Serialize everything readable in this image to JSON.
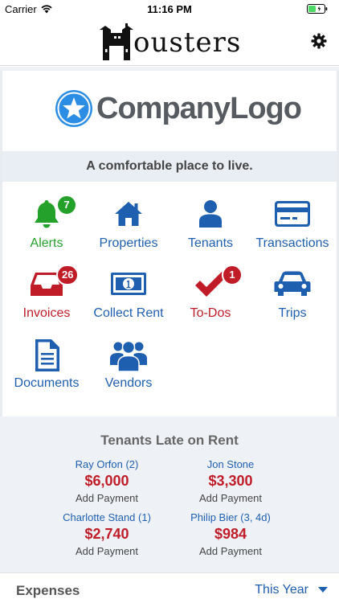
{
  "status_bar": {
    "carrier": "Carrier",
    "time": "11:16 PM"
  },
  "header": {
    "title": "ousters",
    "settings_icon": "gear-icon"
  },
  "company": {
    "logo_text": "CompanyLogo",
    "tagline": "A comfortable place to live."
  },
  "tiles": [
    {
      "label": "Alerts",
      "icon": "bell-icon",
      "badge": "7"
    },
    {
      "label": "Properties",
      "icon": "house-icon"
    },
    {
      "label": "Tenants",
      "icon": "person-icon"
    },
    {
      "label": "Transactions",
      "icon": "credit-card-icon"
    },
    {
      "label": "Invoices",
      "icon": "inbox-tray-icon",
      "badge": "26"
    },
    {
      "label": "Collect Rent",
      "icon": "banknote-icon"
    },
    {
      "label": "To-Dos",
      "icon": "checkmark-icon",
      "badge": "1"
    },
    {
      "label": "Trips",
      "icon": "car-icon"
    },
    {
      "label": "Documents",
      "icon": "document-icon"
    },
    {
      "label": "Vendors",
      "icon": "group-icon"
    }
  ],
  "late_rent": {
    "title": "Tenants Late on Rent",
    "entries": [
      {
        "name": "Ray Orfon (2)",
        "amount": "$6,000",
        "action": "Add Payment"
      },
      {
        "name": "Jon Stone",
        "amount": "$3,300",
        "action": "Add Payment"
      },
      {
        "name": "Charlotte Stand (1)",
        "amount": "$2,740",
        "action": "Add Payment"
      },
      {
        "name": "Philip Bier (3, 4d)",
        "amount": "$984",
        "action": "Add Payment"
      }
    ]
  },
  "expenses": {
    "label": "Expenses",
    "period": "This Year"
  },
  "colors": {
    "green": "#23a12a",
    "blue": "#1f5fb0",
    "red": "#c01c28",
    "logo_blue": "#2b8ee4",
    "logo_gray": "#555b61"
  }
}
